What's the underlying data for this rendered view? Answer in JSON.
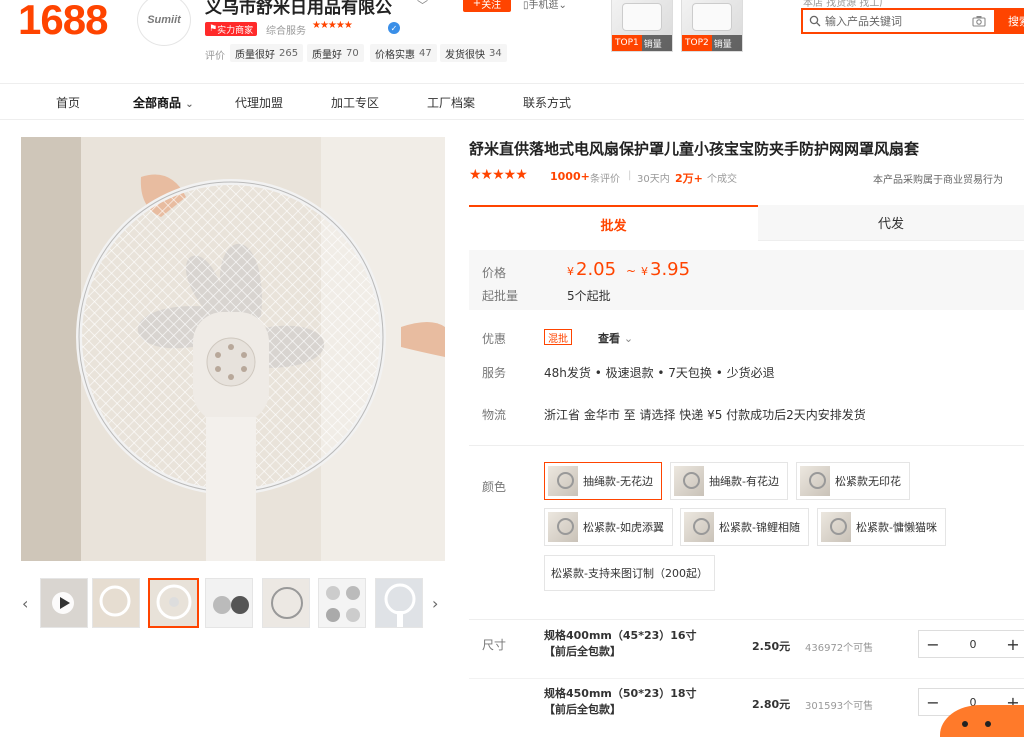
{
  "header": {
    "logo": "1688",
    "shop_avatar_text": "Sumiit",
    "shop_name": "义乌市舒米日用品有限公",
    "follow": "关注",
    "mobile_shop": "手机逛",
    "power_merchant": "实力商家",
    "overall_label": "综合服务",
    "overall_stars": "★★★★★",
    "rating_label": "评价",
    "rating_tags": [
      {
        "label": "质量很好",
        "count": "265"
      },
      {
        "label": "质量好",
        "count": "70"
      },
      {
        "label": "价格实惠",
        "count": "47"
      },
      {
        "label": "发货很快",
        "count": "34"
      }
    ],
    "top_products": [
      {
        "rank": "TOP1",
        "label": "销量"
      },
      {
        "rank": "TOP2",
        "label": "销量"
      }
    ],
    "search": {
      "links": "本店   找货源   找工厂",
      "placeholder": "输入产品关键词",
      "button": "搜索"
    }
  },
  "nav": {
    "items": [
      {
        "label": "首页"
      },
      {
        "label": "全部商品"
      },
      {
        "label": "代理加盟"
      },
      {
        "label": "加工专区"
      },
      {
        "label": "工厂档案"
      },
      {
        "label": "联系方式"
      }
    ]
  },
  "product": {
    "title": "舒米直供落地式电风扇保护罩儿童小孩宝宝防夹手防护网网罩风扇套",
    "stars": "★★★★★",
    "review_count": "1000+",
    "review_label": "条评价",
    "sold_period": "30天内",
    "sold_count": "2万+",
    "sold_label": "个成交",
    "trade_note": "本产品采购属于商业贸易行为",
    "tabs": [
      "批发",
      "代发"
    ],
    "price_label": "价格",
    "currency": "¥",
    "price_low": "2.05",
    "price_tilde": "~",
    "price_high": "3.95",
    "moq_label": "起批量",
    "moq_value": "5个起批",
    "promo_label": "优惠",
    "promo_badge": "混批",
    "promo_view": "查看",
    "service_label": "服务",
    "service_text": "48h发货 • 极速退款 • 7天包换 • 少货必退",
    "logistics_label": "物流",
    "logistics_text": "浙江省 金华市   至   请选择      快递  ¥5       付款成功后2天内安排发货",
    "color_label": "颜色",
    "colors": [
      {
        "label": "抽绳款-无花边"
      },
      {
        "label": "抽绳款-有花边"
      },
      {
        "label": "松紧款无印花"
      },
      {
        "label": "松紧款-如虎添翼"
      },
      {
        "label": "松紧款-锦鲤相随"
      },
      {
        "label": "松紧款-慵懒猫咪"
      }
    ],
    "custom_option": "松紧款-支持来图订制（200起）",
    "size_label": "尺寸",
    "sizes": [
      {
        "line1": "规格400mm（45*23）16寸",
        "line2": "【前后全包款】",
        "price": "2.50元",
        "stock": "436972个可售",
        "qty": "0"
      },
      {
        "line1": "规格450mm（50*23）18寸",
        "line2": "【前后全包款】",
        "price": "2.80元",
        "stock": "301593个可售",
        "qty": "0"
      }
    ]
  },
  "colors": {
    "brand": "#ff4400"
  }
}
